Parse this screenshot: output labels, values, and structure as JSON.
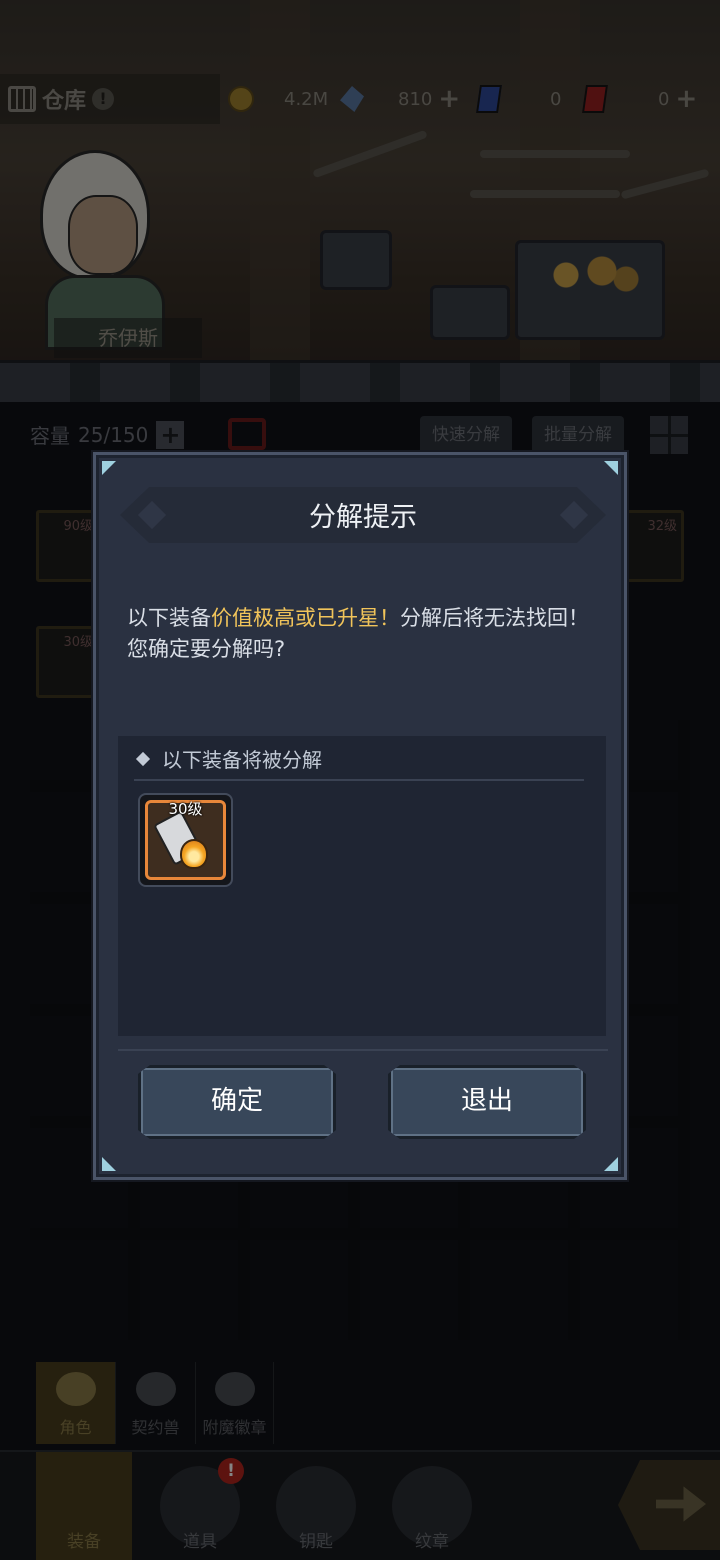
{
  "top": {
    "warehouse_title": "仓库",
    "resources": [
      {
        "icon": "gold-coin-icon",
        "value": "4.2M",
        "has_plus": false
      },
      {
        "icon": "blue-crystal-icon",
        "value": "810",
        "has_plus": true
      },
      {
        "icon": "blue-card-icon",
        "value": "0",
        "has_plus": false
      },
      {
        "icon": "red-card-icon",
        "value": "0",
        "has_plus": true
      }
    ],
    "plus_symbol": "+"
  },
  "hero": {
    "name": "乔伊斯"
  },
  "inventory": {
    "capacity_label": "容量",
    "capacity_value": "25/150",
    "quick_decompose": "快速分解",
    "batch_decompose": "批量分解",
    "slot_levels": [
      "90级",
      "32级",
      "30级"
    ]
  },
  "dialog": {
    "title": "分解提示",
    "message_before": "以下装备",
    "message_highlight": "价值极高或已升星！",
    "message_after": "分解后将无法找回！您确定要分解吗?",
    "list_header": "以下装备将被分解",
    "items": [
      {
        "level": "30级",
        "icon": "flame-blade-icon",
        "border_color": "#e8873a"
      }
    ],
    "confirm_label": "确定",
    "exit_label": "退出",
    "highlight_color": "#f1c45a"
  },
  "subtabs": [
    {
      "label": "角色",
      "active": true
    },
    {
      "label": "契约兽",
      "active": false
    },
    {
      "label": "附魔徽章",
      "active": false
    }
  ],
  "nav": [
    {
      "label": "装备",
      "active": true
    },
    {
      "label": "道具",
      "active": false,
      "badge": "!"
    },
    {
      "label": "钥匙",
      "active": false
    },
    {
      "label": "纹章",
      "active": false
    }
  ]
}
